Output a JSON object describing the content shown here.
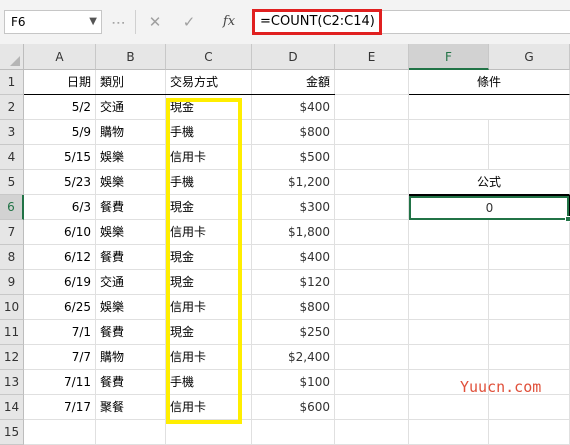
{
  "formula_bar": {
    "name_box": "F6",
    "cancel_glyph": "✕",
    "enter_glyph": "✓",
    "fx_label": "fx",
    "formula": "=COUNT(C2:C14)"
  },
  "columns": [
    "A",
    "B",
    "C",
    "D",
    "E",
    "F",
    "G"
  ],
  "selected_column": "F",
  "rows": [
    "1",
    "2",
    "3",
    "4",
    "5",
    "6",
    "7",
    "8",
    "9",
    "10",
    "11",
    "12",
    "13",
    "14",
    "15"
  ],
  "selected_row": "6",
  "headers": {
    "a": "日期",
    "b": "類別",
    "c": "交易方式",
    "d": "金額"
  },
  "data": [
    {
      "date": "5/2",
      "cat": "交通",
      "method": "現金",
      "amount": "$400"
    },
    {
      "date": "5/9",
      "cat": "購物",
      "method": "手機",
      "amount": "$800"
    },
    {
      "date": "5/15",
      "cat": "娛樂",
      "method": "信用卡",
      "amount": "$500"
    },
    {
      "date": "5/23",
      "cat": "娛樂",
      "method": "手機",
      "amount": "$1,200"
    },
    {
      "date": "6/3",
      "cat": "餐費",
      "method": "現金",
      "amount": "$300"
    },
    {
      "date": "6/10",
      "cat": "娛樂",
      "method": "信用卡",
      "amount": "$1,800"
    },
    {
      "date": "6/12",
      "cat": "餐費",
      "method": "現金",
      "amount": "$400"
    },
    {
      "date": "6/19",
      "cat": "交通",
      "method": "現金",
      "amount": "$120"
    },
    {
      "date": "6/25",
      "cat": "娛樂",
      "method": "信用卡",
      "amount": "$800"
    },
    {
      "date": "7/1",
      "cat": "餐費",
      "method": "現金",
      "amount": "$250"
    },
    {
      "date": "7/7",
      "cat": "購物",
      "method": "信用卡",
      "amount": "$2,400"
    },
    {
      "date": "7/11",
      "cat": "餐費",
      "method": "手機",
      "amount": "$100"
    },
    {
      "date": "7/17",
      "cat": "聚餐",
      "method": "信用卡",
      "amount": "$600"
    }
  ],
  "side": {
    "condition_label": "條件",
    "formula_label": "公式",
    "result": "0"
  },
  "watermark": "Yuucn.com",
  "colors": {
    "highlight_formula": "#e02020",
    "highlight_range": "#ffee00",
    "selection": "#217346"
  }
}
